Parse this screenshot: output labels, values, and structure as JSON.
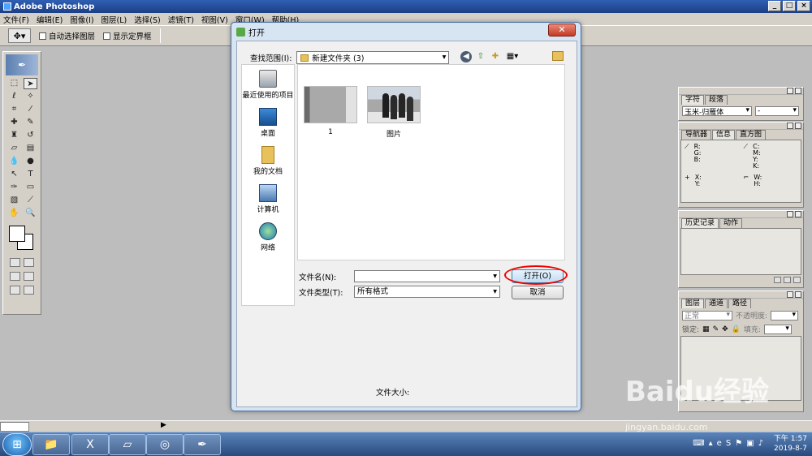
{
  "app": {
    "title": "Adobe Photoshop"
  },
  "menubar": {
    "items": [
      "文件(F)",
      "编辑(E)",
      "图像(I)",
      "图层(L)",
      "选择(S)",
      "滤镜(T)",
      "视图(V)",
      "窗口(W)",
      "帮助(H)"
    ]
  },
  "optionsbar": {
    "auto_select": "自动选择图层",
    "show_bounds": "显示定界框"
  },
  "dialog": {
    "title": "打开",
    "look_in_label": "查找范围(I):",
    "look_in_value": "新建文件夹 (3)",
    "places": [
      "最近使用的项目",
      "桌面",
      "我的文档",
      "计算机",
      "网络"
    ],
    "files": [
      {
        "name": "1"
      },
      {
        "name": "图片"
      }
    ],
    "filename_label": "文件名(N):",
    "filename_value": "",
    "filetype_label": "文件类型(T):",
    "filetype_value": "所有格式",
    "open_button": "打开(O)",
    "cancel_button": "取消",
    "filesize_label": "文件大小:"
  },
  "panels": {
    "character": {
      "tabs": [
        "字符",
        "段落"
      ],
      "font": "玉米-归雁体",
      "style": "-"
    },
    "info": {
      "tabs": [
        "导航器",
        "信息",
        "直方图"
      ],
      "rgb": [
        "R:",
        "G:",
        "B:"
      ],
      "cmyk": [
        "C:",
        "M:",
        "Y:",
        "K:"
      ],
      "xy": [
        "X:",
        "Y:"
      ],
      "wh": [
        "W:",
        "H:"
      ]
    },
    "history": {
      "tabs": [
        "历史记录",
        "动作"
      ]
    },
    "layers": {
      "tabs": [
        "图层",
        "通道",
        "路径"
      ],
      "blend": "正常",
      "opacity_label": "不透明度:",
      "lock_label": "锁定:",
      "fill_label": "填充:"
    }
  },
  "taskbar": {
    "time": "下午 1:57",
    "date": "2019-8-7"
  },
  "watermark": {
    "text": "Baidu经验",
    "sub": "jingyan.baidu.com"
  },
  "colors": {
    "title_bar": "#1c3f86",
    "dialog_frame": "#d7e4f2",
    "highlight": "#e00000"
  }
}
